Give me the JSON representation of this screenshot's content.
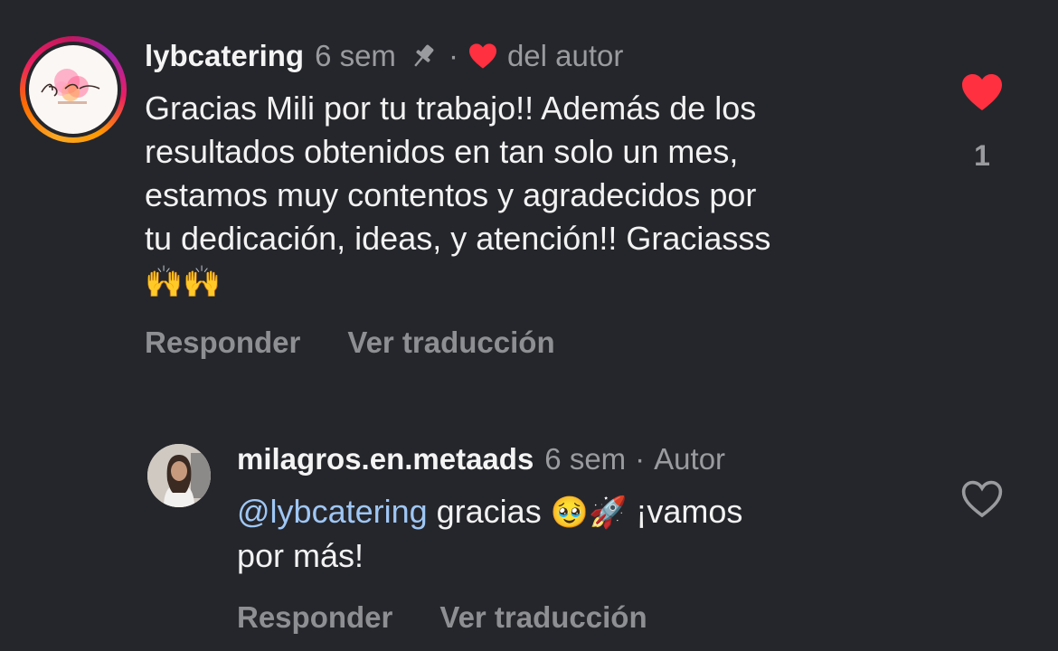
{
  "comments": [
    {
      "username": "lybcatering",
      "time": "6 sem",
      "pinned": true,
      "liked_by_author_label": "del autor",
      "avatar_logo_text": "LyBCatering",
      "text_lines": [
        "Gracias Mili por tu trabajo!! Además de los",
        "resultados obtenidos en tan solo un mes,",
        "estamos muy contentos y agradecidos por",
        "tu dedicación, ideas, y atención!! Graciasss"
      ],
      "emoji_line": "🙌🙌",
      "reply_label": "Responder",
      "translate_label": "Ver traducción",
      "liked": true,
      "like_count": "1",
      "heart_color": "#ff3040"
    },
    {
      "username": "milagros.en.metaads",
      "time": "6 sem",
      "author_badge": "Autor",
      "mention": "@lybcatering",
      "text_after_mention": " gracias ",
      "emojis": "🥹🚀",
      "text_line1_end": " ¡vamos",
      "text_line2": "por más!",
      "reply_label": "Responder",
      "translate_label": "Ver traducción",
      "liked": false
    }
  ],
  "colors": {
    "background": "#25262b",
    "mention": "#9fc7f5",
    "secondary_text": "#9a9b9f",
    "like_red": "#ff3040"
  }
}
